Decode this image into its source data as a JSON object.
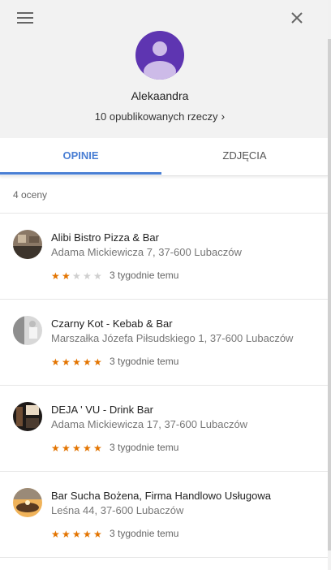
{
  "profile": {
    "name": "Alekaandra",
    "published_text": "10 opublikowanych rzeczy",
    "published_chevron": "›"
  },
  "tabs": [
    {
      "label": "OPINIE",
      "active": true
    },
    {
      "label": "ZDJĘCIA",
      "active": false
    }
  ],
  "reviews_count": "4 oceny",
  "reviews": [
    {
      "name": "Alibi Bistro Pizza & Bar",
      "address": "Adama Mickiewicza 7, 37-600 Lubaczów",
      "rating": 2,
      "time": "3 tygodnie temu"
    },
    {
      "name": "Czarny Kot - Kebab & Bar",
      "address": "Marszałka Józefa Piłsudskiego 1, 37-600 Lubaczów",
      "rating": 5,
      "time": "3 tygodnie temu"
    },
    {
      "name": "DEJA ' VU - Drink Bar",
      "address": "Adama Mickiewicza 17, 37-600 Lubaczów",
      "rating": 5,
      "time": "3 tygodnie temu"
    },
    {
      "name": "Bar Sucha Bożena, Firma Handlowo Usługowa",
      "address": "Leśna 44, 37-600 Lubaczów",
      "rating": 5,
      "time": "3 tygodnie temu"
    }
  ],
  "colors": {
    "accent": "#4a7fd4",
    "star": "#e37400",
    "avatar": "#5e35b1"
  },
  "icons": {
    "menu": "menu-icon",
    "close": "close-icon",
    "avatar": "person-icon",
    "star": "star-icon"
  }
}
